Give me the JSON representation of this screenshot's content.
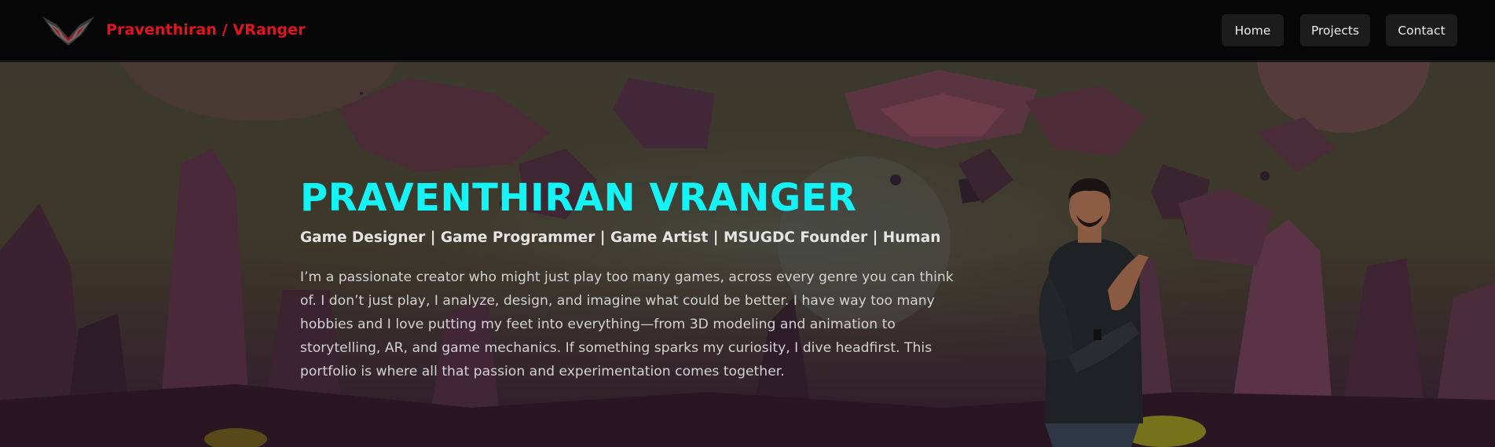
{
  "header": {
    "brand": "Praventhiran / VRanger",
    "nav": [
      {
        "label": "Home"
      },
      {
        "label": "Projects"
      },
      {
        "label": "Contact"
      }
    ]
  },
  "hero": {
    "title": "PRAVENTHIRAN VRANGER",
    "subtitle": "Game Designer | Game Programmer | Game Artist | MSUGDC Founder | Human",
    "description": "I’m a passionate creator who might just play too many games, across every genre you can think of. I don’t just play, I analyze, design, and imagine what could be better. I have way too many hobbies and I love putting my feet into everything—from 3D modeling and animation to storytelling, AR, and game mechanics. If something sparks my curiosity, I dive headfirst. This portfolio is where all that passion and experimentation comes together."
  },
  "colors": {
    "brand": "#e3131f",
    "title": "#14f3f5",
    "nav_bg": "#070707",
    "button_bg": "#1c1c1c"
  },
  "icons": [
    "v-wings-logo-icon",
    "hero-portrait-image",
    "alien-landscape-background"
  ]
}
